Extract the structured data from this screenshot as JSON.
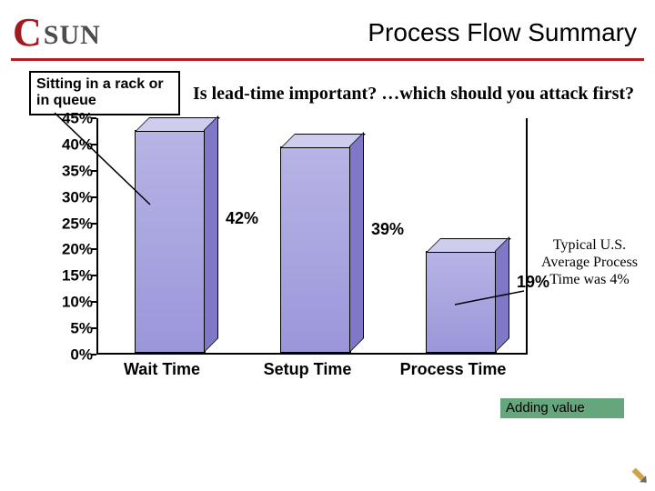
{
  "logo": {
    "c": "C",
    "sun": "SUN"
  },
  "title": "Process Flow Summary",
  "question": "Is lead-time important? …which should you attack first?",
  "callout_top": "Sitting in a rack or in queue",
  "callout_bottom": "Adding value",
  "side_note": "Typical U.S. Average Process Time was 4%",
  "chart_data": {
    "type": "bar",
    "categories": [
      "Wait Time",
      "Setup Time",
      "Process Time"
    ],
    "values": [
      42,
      39,
      19
    ],
    "title": "",
    "xlabel": "",
    "ylabel": "",
    "ylim": [
      0,
      45
    ],
    "y_ticks": [
      "0%",
      "5%",
      "10%",
      "15%",
      "20%",
      "25%",
      "30%",
      "35%",
      "40%",
      "45%"
    ],
    "data_labels": [
      "42%",
      "39%",
      "19%"
    ]
  }
}
